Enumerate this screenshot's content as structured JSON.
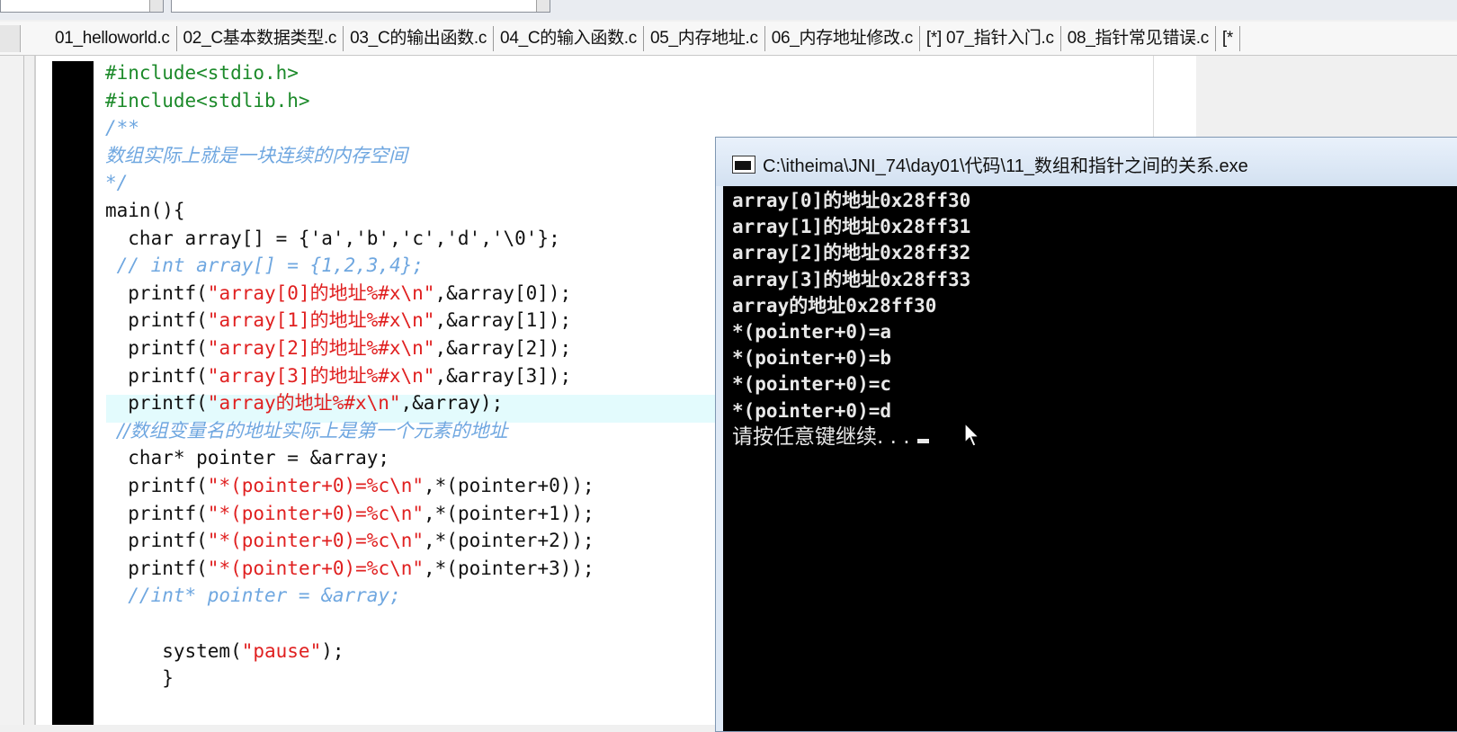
{
  "tabs": [
    "01_helloworld.c",
    "02_C基本数据类型.c",
    "03_C的输出函数.c",
    "04_C的输入函数.c",
    "05_内存地址.c",
    "06_内存地址修改.c",
    "[*] 07_指针入门.c",
    "08_指针常见错误.c",
    "[*"
  ],
  "code": [
    {
      "parts": [
        {
          "t": "#include<stdio.h>",
          "k": "g"
        }
      ]
    },
    {
      "parts": [
        {
          "t": "#include<stdlib.h>",
          "k": "g"
        }
      ]
    },
    {
      "parts": [
        {
          "t": "/**",
          "k": "c"
        }
      ]
    },
    {
      "parts": [
        {
          "t": "数组实际上就是一块连续的内存空间",
          "k": "cm"
        }
      ]
    },
    {
      "parts": [
        {
          "t": "*/",
          "k": "c"
        }
      ]
    },
    {
      "parts": [
        {
          "t": "main(){",
          "k": "n"
        }
      ]
    },
    {
      "parts": [
        {
          "t": "  char array[] = {'a','b','c','d','\\0'};",
          "k": "n"
        }
      ]
    },
    {
      "parts": [
        {
          "t": " // int array[] = {1,2,3,4};",
          "k": "c"
        }
      ]
    },
    {
      "parts": [
        {
          "t": "  printf(",
          "k": "n"
        },
        {
          "t": "\"array[0]的地址%#x\\n\"",
          "k": "s"
        },
        {
          "t": ",&array[0]);",
          "k": "n"
        }
      ]
    },
    {
      "parts": [
        {
          "t": "  printf(",
          "k": "n"
        },
        {
          "t": "\"array[1]的地址%#x\\n\"",
          "k": "s"
        },
        {
          "t": ",&array[1]);",
          "k": "n"
        }
      ]
    },
    {
      "parts": [
        {
          "t": "  printf(",
          "k": "n"
        },
        {
          "t": "\"array[2]的地址%#x\\n\"",
          "k": "s"
        },
        {
          "t": ",&array[2]);",
          "k": "n"
        }
      ]
    },
    {
      "parts": [
        {
          "t": "  printf(",
          "k": "n"
        },
        {
          "t": "\"array[3]的地址%#x\\n\"",
          "k": "s"
        },
        {
          "t": ",&array[3]);",
          "k": "n"
        }
      ]
    },
    {
      "parts": [
        {
          "t": "  printf(",
          "k": "n"
        },
        {
          "t": "\"array的地址%#x\\n\"",
          "k": "s"
        },
        {
          "t": ",&array);",
          "k": "n"
        }
      ]
    },
    {
      "parts": [
        {
          "t": "  //数组变量名的地址实际上是第一个元素的地址",
          "k": "cm"
        }
      ]
    },
    {
      "parts": [
        {
          "t": "  char* pointer = &array;",
          "k": "n"
        }
      ]
    },
    {
      "parts": [
        {
          "t": "  printf(",
          "k": "n"
        },
        {
          "t": "\"*(pointer+0)=%c\\n\"",
          "k": "s"
        },
        {
          "t": ",*(pointer+0));",
          "k": "n"
        }
      ]
    },
    {
      "parts": [
        {
          "t": "  printf(",
          "k": "n"
        },
        {
          "t": "\"*(pointer+0)=%c\\n\"",
          "k": "s"
        },
        {
          "t": ",*(pointer+1));",
          "k": "n"
        }
      ]
    },
    {
      "parts": [
        {
          "t": "  printf(",
          "k": "n"
        },
        {
          "t": "\"*(pointer+0)=%c\\n\"",
          "k": "s"
        },
        {
          "t": ",*(pointer+2));",
          "k": "n"
        }
      ]
    },
    {
      "parts": [
        {
          "t": "  printf(",
          "k": "n"
        },
        {
          "t": "\"*(pointer+0)=%c\\n\"",
          "k": "s"
        },
        {
          "t": ",*(pointer+3));",
          "k": "n"
        }
      ]
    },
    {
      "parts": [
        {
          "t": "  //int* pointer = &array;",
          "k": "c"
        }
      ]
    },
    {
      "parts": [
        {
          "t": "",
          "k": "n"
        }
      ]
    },
    {
      "parts": [
        {
          "t": "     system(",
          "k": "n"
        },
        {
          "t": "\"pause\"",
          "k": "s"
        },
        {
          "t": ");",
          "k": "n"
        }
      ]
    },
    {
      "parts": [
        {
          "t": "     }",
          "k": "n"
        }
      ]
    }
  ],
  "console": {
    "title": "C:\\itheima\\JNI_74\\day01\\代码\\11_数组和指针之间的关系.exe",
    "lines": [
      "array[0]的地址0x28ff30",
      "array[1]的地址0x28ff31",
      "array[2]的地址0x28ff32",
      "array[3]的地址0x28ff33",
      "array的地址0x28ff30",
      "*(pointer+0)=a",
      "*(pointer+0)=b",
      "*(pointer+0)=c",
      "*(pointer+0)=d"
    ],
    "prompt": "请按任意键继续. . ."
  }
}
